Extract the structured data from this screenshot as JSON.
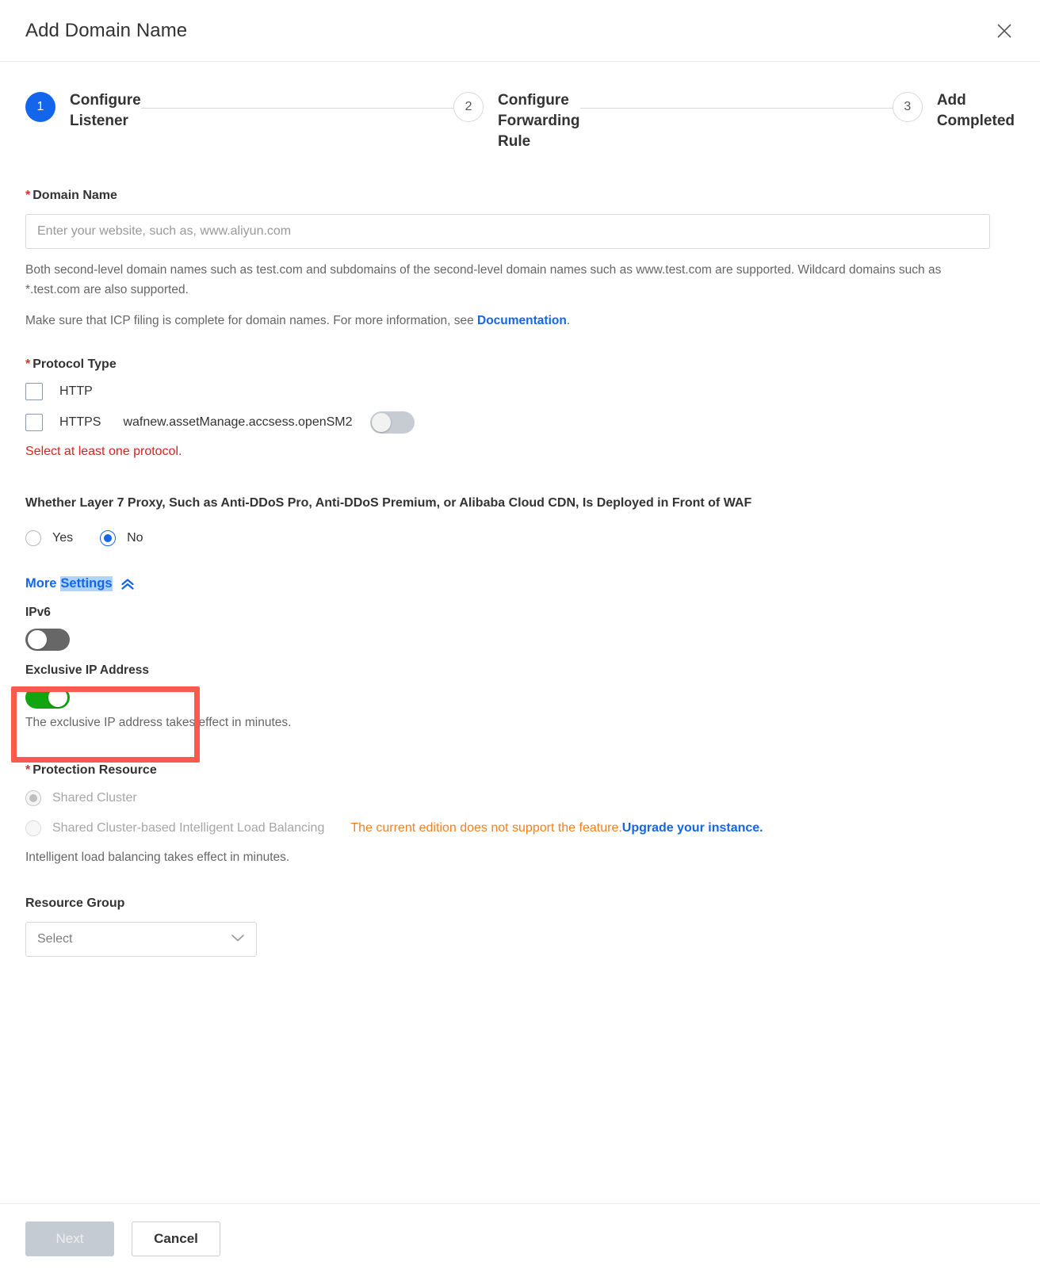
{
  "dialog": {
    "title": "Add Domain Name",
    "close_icon": "close-icon"
  },
  "steps": [
    {
      "number": "1",
      "label": "Configure\nListener",
      "state": "active"
    },
    {
      "number": "2",
      "label": "Configure\nForwarding\nRule",
      "state": "inactive"
    },
    {
      "number": "3",
      "label": "Add\nCompleted",
      "state": "inactive"
    }
  ],
  "domain_name": {
    "required_mark": "*",
    "label": "Domain Name",
    "input_value": "",
    "placeholder": "Enter your website, such as, www.aliyun.com",
    "help_line_1": "Both second-level domain names such as test.com and subdomains of the second-level domain names such as www.test.com are supported. Wildcard domains such as *.test.com are also supported.",
    "help_line_2_prefix": "Make sure that ICP filing is complete for domain names. For more information, see ",
    "help_line_2_link": "Documentation",
    "help_line_2_suffix": "."
  },
  "protocol_type": {
    "required_mark": "*",
    "label": "Protocol Type",
    "http": {
      "label": "HTTP",
      "checked": false
    },
    "https": {
      "label": "HTTPS",
      "checked": false
    },
    "sm2_tag": "wafnew.assetManage.accsess.openSM2",
    "sm2_toggle_state": "off",
    "error": "Select at least one protocol."
  },
  "layer7_proxy": {
    "question": "Whether Layer 7 Proxy, Such as Anti-DDoS Pro, Anti-DDoS Premium, or Alibaba Cloud CDN, Is Deployed in Front of WAF",
    "options": [
      {
        "label": "Yes",
        "selected": false
      },
      {
        "label": "No",
        "selected": true
      }
    ]
  },
  "more_settings": {
    "more_text": "More",
    "settings_text": "Settings",
    "chevron_icon": "chevron-double-up-icon",
    "expanded": true
  },
  "ipv6": {
    "label": "IPv6",
    "toggle_state": "off"
  },
  "exclusive_ip": {
    "label": "Exclusive IP Address",
    "toggle_state": "on",
    "note": "The exclusive IP address takes effect in minutes.",
    "highlight_color": "#fa5a4b"
  },
  "protection_resource": {
    "required_mark": "*",
    "label": "Protection Resource",
    "options": [
      {
        "label": "Shared Cluster",
        "selected": true,
        "disabled": true
      },
      {
        "label": "Shared Cluster-based Intelligent Load Balancing",
        "selected": false,
        "disabled": true
      }
    ],
    "feature_message": "The current edition does not support the feature.",
    "feature_link": "Upgrade your instance.",
    "note": "Intelligent load balancing takes effect in minutes."
  },
  "resource_group": {
    "label": "Resource Group",
    "selected_value": "Select",
    "chevron_icon": "chevron-down-icon"
  },
  "footer": {
    "next_label": "Next",
    "next_disabled": true,
    "cancel_label": "Cancel"
  },
  "colors": {
    "accent_blue": "#1366ec",
    "error_red": "#e02020",
    "warn_orange": "#f68020",
    "toggle_green": "#11a60f",
    "annotation_red": "#fa5a4b"
  }
}
